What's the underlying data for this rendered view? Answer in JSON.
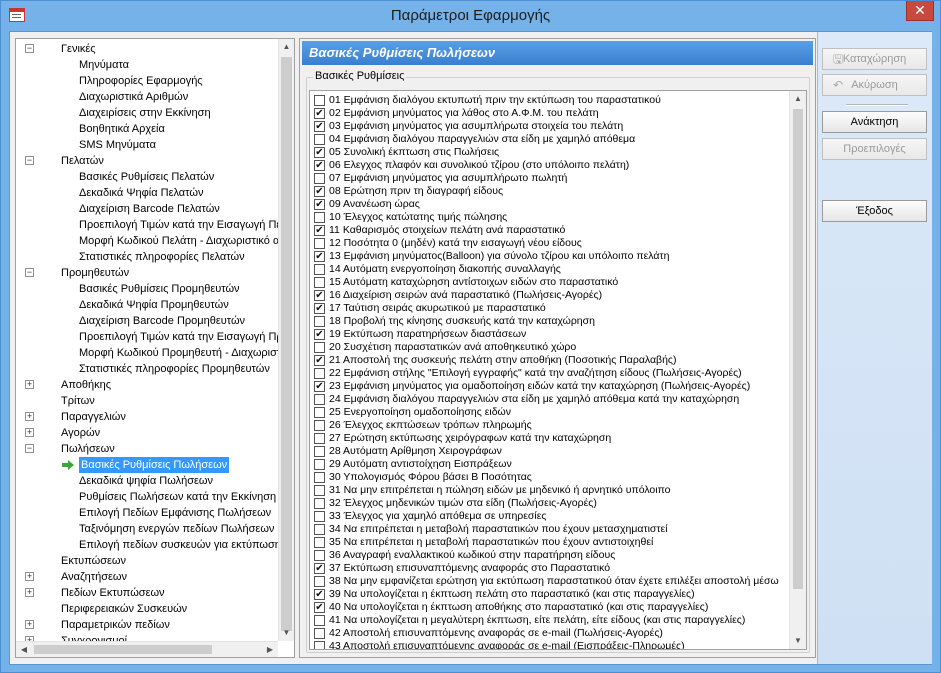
{
  "window": {
    "title": "Παράμετροι Εφαρμογής",
    "close_glyph": "✕"
  },
  "tree": {
    "nodes": [
      {
        "label": "Γενικές",
        "level": 0,
        "expander": "−"
      },
      {
        "label": "Μηνύματα",
        "level": 1
      },
      {
        "label": "Πληροφορίες Εφαρμογής",
        "level": 1
      },
      {
        "label": "Διαχωριστικά Αριθμών",
        "level": 1
      },
      {
        "label": "Διαχειρίσεις στην Εκκίνηση",
        "level": 1
      },
      {
        "label": "Βοηθητικά Αρχεία",
        "level": 1
      },
      {
        "label": "SMS Μηνύματα",
        "level": 1
      },
      {
        "label": "Πελατών",
        "level": 0,
        "expander": "−"
      },
      {
        "label": "Βασικές Ρυθμίσεις Πελατών",
        "level": 1
      },
      {
        "label": "Δεκαδικά Ψηφία Πελατών",
        "level": 1
      },
      {
        "label": "Διαχείριση Barcode Πελατών",
        "level": 1
      },
      {
        "label": "Προεπιλογή Τιμών κατά την Εισαγωγή Πε",
        "level": 1
      },
      {
        "label": "Μορφή Κωδικού Πελάτη - Διαχωριστικό α",
        "level": 1
      },
      {
        "label": "Στατιστικές πληροφορίες Πελατών",
        "level": 1
      },
      {
        "label": "Προμηθευτών",
        "level": 0,
        "expander": "−"
      },
      {
        "label": "Βασικές Ρυθμίσεις Προμηθευτών",
        "level": 1
      },
      {
        "label": "Δεκαδικά Ψηφία Προμηθευτών",
        "level": 1
      },
      {
        "label": "Διαχείριση Barcode Προμηθευτών",
        "level": 1
      },
      {
        "label": "Προεπιλογή Τιμών κατά την Εισαγωγή Πρ",
        "level": 1
      },
      {
        "label": "Μορφή Κωδικού Προμηθευτή - Διαχωριστ",
        "level": 1
      },
      {
        "label": "Στατιστικές πληροφορίες Προμηθευτών",
        "level": 1
      },
      {
        "label": "Αποθήκης",
        "level": 0,
        "expander": "+"
      },
      {
        "label": "Τρίτων",
        "level": 0
      },
      {
        "label": "Παραγγελιών",
        "level": 0,
        "expander": "+"
      },
      {
        "label": "Αγορών",
        "level": 0,
        "expander": "+"
      },
      {
        "label": "Πωλήσεων",
        "level": 0,
        "expander": "−"
      },
      {
        "label": "Βασικές Ρυθμίσεις Πωλήσεων",
        "level": 1,
        "selected": true
      },
      {
        "label": "Δεκαδικά ψηφία Πωλήσεων",
        "level": 1
      },
      {
        "label": "Ρυθμίσεις Πωλήσεων κατά την Εκκίνηση",
        "level": 1
      },
      {
        "label": "Επιλογή Πεδίων Εμφάνισης Πωλήσεων",
        "level": 1
      },
      {
        "label": "Ταξινόμηση ενεργών πεδίων Πωλήσεων",
        "level": 1
      },
      {
        "label": "Επιλογή πεδίων συσκευών για εκτύπωση",
        "level": 1
      },
      {
        "label": "Εκτυπώσεων",
        "level": 0
      },
      {
        "label": "Αναζητήσεων",
        "level": 0,
        "expander": "+"
      },
      {
        "label": "Πεδίων Εκτυπώσεων",
        "level": 0,
        "expander": "+"
      },
      {
        "label": "Περιφερειακών Συσκευών",
        "level": 0
      },
      {
        "label": "Παραμετρικών πεδίων",
        "level": 0,
        "expander": "+"
      },
      {
        "label": "Συγχρονισμοί",
        "level": 0,
        "expander": "+"
      }
    ]
  },
  "main": {
    "header": "Βασικές Ρυθμίσεις Πωλήσεων",
    "group_title": "Βασικές Ρυθμίσεις",
    "options": [
      {
        "text": "01  Εμφάνιση διαλόγου εκτυπωτή πριν την εκτύπωση του παραστατικού",
        "checked": false
      },
      {
        "text": "02  Εμφάνιση μηνύματος για λάθος στο Α.Φ.Μ. του πελάτη",
        "checked": true
      },
      {
        "text": "03  Εμφάνιση μηνύματος για ασυμπλήρωτα στοιχεία του πελάτη",
        "checked": true
      },
      {
        "text": "04  Εμφάνιση διαλόγου παραγγελιών στα είδη με χαμηλό απόθεμα",
        "checked": false
      },
      {
        "text": "05  Συνολική έκπτωση στις Πωλήσεις",
        "checked": true
      },
      {
        "text": "06  Ελεγχος πλαφόν και συνολικού τζίρου (στο υπόλοιπο πελάτη)",
        "checked": true
      },
      {
        "text": "07  Εμφάνιση μηνύματος για ασυμπλήρωτο πωλητή",
        "checked": false
      },
      {
        "text": "08  Ερώτηση πριν τη διαγραφή είδους",
        "checked": true
      },
      {
        "text": "09  Ανανέωση ώρας",
        "checked": true
      },
      {
        "text": "10  Έλεγχος κατώτατης τιμής πώλησης",
        "checked": false
      },
      {
        "text": "11  Καθαρισμός στοιχείων πελάτη ανά παραστατικό",
        "checked": true
      },
      {
        "text": "12  Ποσότητα 0 (μηδέν) κατά την εισαγωγή νέου είδους",
        "checked": false
      },
      {
        "text": "13  Εμφάνιση μηνύματος(Balloon) για σύνολο τζίρου και υπόλοιπο πελάτη",
        "checked": true
      },
      {
        "text": "14  Αυτόματη ενεργοποίηση διακοπής συναλλαγής",
        "checked": false
      },
      {
        "text": "15  Αυτόματη καταχώρηση αντίστοιχων ειδών στο παραστατικό",
        "checked": false
      },
      {
        "text": "16  Διαχείριση σειρών ανά παραστατικό (Πωλήσεις-Αγορές)",
        "checked": true
      },
      {
        "text": "17  Ταύτιση σειράς ακυρωτικού με παραστατικό",
        "checked": true
      },
      {
        "text": "18  Προβολή της κίνησης συσκευής κατά την καταχώρηση",
        "checked": false
      },
      {
        "text": "19  Εκτύπωση παρατηρήσεων διαστάσεων",
        "checked": true
      },
      {
        "text": "20  Συσχέτιση παραστατικών ανά αποθηκευτικό χώρο",
        "checked": false
      },
      {
        "text": "21  Αποστολή της συσκευής πελάτη στην αποθήκη (Ποσοτικής Παραλαβής)",
        "checked": true
      },
      {
        "text": "22  Εμφάνιση στήλης \"Επιλογή εγγραφής\" κατά την αναζήτηση είδους (Πωλήσεις-Αγορές)",
        "checked": false
      },
      {
        "text": "23  Εμφάνιση μηνύματος για ομαδοποίηση ειδών κατά την καταχώρηση (Πωλήσεις-Αγορές)",
        "checked": true
      },
      {
        "text": "24  Εμφάνιση διαλόγου παραγγελιών στα είδη με χαμηλό απόθεμα κατά την καταχώρηση",
        "checked": false
      },
      {
        "text": "25  Ενεργοποίηση ομαδοποίησης ειδών",
        "checked": false
      },
      {
        "text": "26  Έλεγχος εκπτώσεων τρόπων πληρωμής",
        "checked": false
      },
      {
        "text": "27  Ερώτηση εκτύπωσης χειρόγραφων κατά την καταχώρηση",
        "checked": false
      },
      {
        "text": "28  Αυτόματη Αρίθμηση Χειρογράφων",
        "checked": false
      },
      {
        "text": "29  Αυτόματη αντιστοίχηση Εισπράξεων",
        "checked": false
      },
      {
        "text": "30  Υπολογισμός Φόρου βάσει Β Ποσότητας",
        "checked": false
      },
      {
        "text": "31  Να μην επιτρέπεται η πώληση ειδών με μηδενικό ή αρνητικό υπόλοιπο",
        "checked": false
      },
      {
        "text": "32  Έλεγχος μηδενικών τιμών στα είδη (Πωλήσεις-Αγορές)",
        "checked": false
      },
      {
        "text": "33  Έλεγχος για χαμηλό απόθεμα σε υπηρεσίες",
        "checked": false
      },
      {
        "text": "34  Να επιτρέπεται η μεταβολή παραστατικών που έχουν μετασχηματιστεί",
        "checked": false
      },
      {
        "text": "35  Να επιτρέπεται η μεταβολή παραστατικών που έχουν αντιστοιχηθεί",
        "checked": false
      },
      {
        "text": "36  Αναγραφή εναλλακτικού κωδικού στην παρατήρηση είδους",
        "checked": false
      },
      {
        "text": "37  Εκτύπωση επισυναπτόμενης αναφοράς στο Παραστατικό",
        "checked": true
      },
      {
        "text": "38  Να μην εμφανίζεται ερώτηση για εκτύπωση παραστατικού όταν έχετε επιλέξει αποστολή μέσω",
        "checked": false
      },
      {
        "text": "39  Να υπολογίζεται η έκπτωση πελάτη στο παραστατικό (και στις παραγγελίες)",
        "checked": true
      },
      {
        "text": "40  Να υπολογίζεται η έκπτωση αποθήκης στο παραστατικό (και στις παραγγελίες)",
        "checked": true
      },
      {
        "text": "41  Να υπολογίζεται η μεγαλύτερη έκπτωση, είτε πελάτη, είτε είδους (και στις παραγγελίες)",
        "checked": false
      },
      {
        "text": "42  Αποστολή επισυναπτόμενης αναφοράς σε e-mail (Πωλήσεις-Αγορές)",
        "checked": false
      },
      {
        "text": "43  Αποστολή επισυναπτόμενης αναφοράς σε e-mail (Εισπράξεις-Πληρωμές)",
        "checked": false
      }
    ]
  },
  "buttons": {
    "save": "Καταχώρηση",
    "cancel": "Ακύρωση",
    "restore": "Ανάκτηση",
    "defaults": "Προεπιλογές",
    "exit": "Έξοδος"
  },
  "icons": {
    "tree_collapse": "−",
    "tree_expand": "+",
    "checkmark": "✔",
    "scroll_up": "▲",
    "scroll_down": "▼",
    "scroll_left": "◀",
    "scroll_right": "▶",
    "selected_arrow": "arrow-right-icon",
    "save_icon": "save-icon",
    "undo_icon": "undo-icon"
  },
  "colors": {
    "title_bar": "#75b2ea",
    "close_button": "#c74a3f",
    "section_header": "#3a7fd0",
    "selection": "#3399ff",
    "selected_arrow": "#3aa83a"
  }
}
